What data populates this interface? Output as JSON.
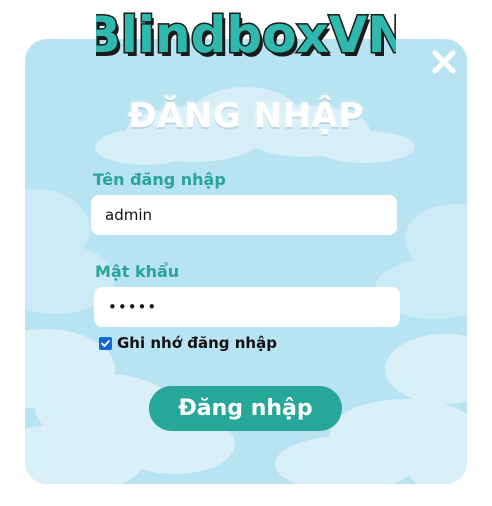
{
  "brand": {
    "logo_text": "BlindboxVN"
  },
  "dialog": {
    "title": "ĐĂNG NHẬP",
    "close_icon": "close-icon",
    "username": {
      "label": "Tên đăng nhập",
      "value": "admin"
    },
    "password": {
      "label": "Mật khẩu",
      "value": "•••••"
    },
    "remember": {
      "label": "Ghi nhớ đăng nhập",
      "checked": true
    },
    "submit_label": "Đăng nhập"
  },
  "colors": {
    "card_background": "#b7e3f2",
    "cloud": "#dff3fa",
    "accent_teal": "#27a69a",
    "label_teal": "#2aa39a",
    "logo_fill": "#2fb8ad",
    "logo_outline": "#1b1b1b",
    "checkbox_blue": "#1466d6"
  }
}
